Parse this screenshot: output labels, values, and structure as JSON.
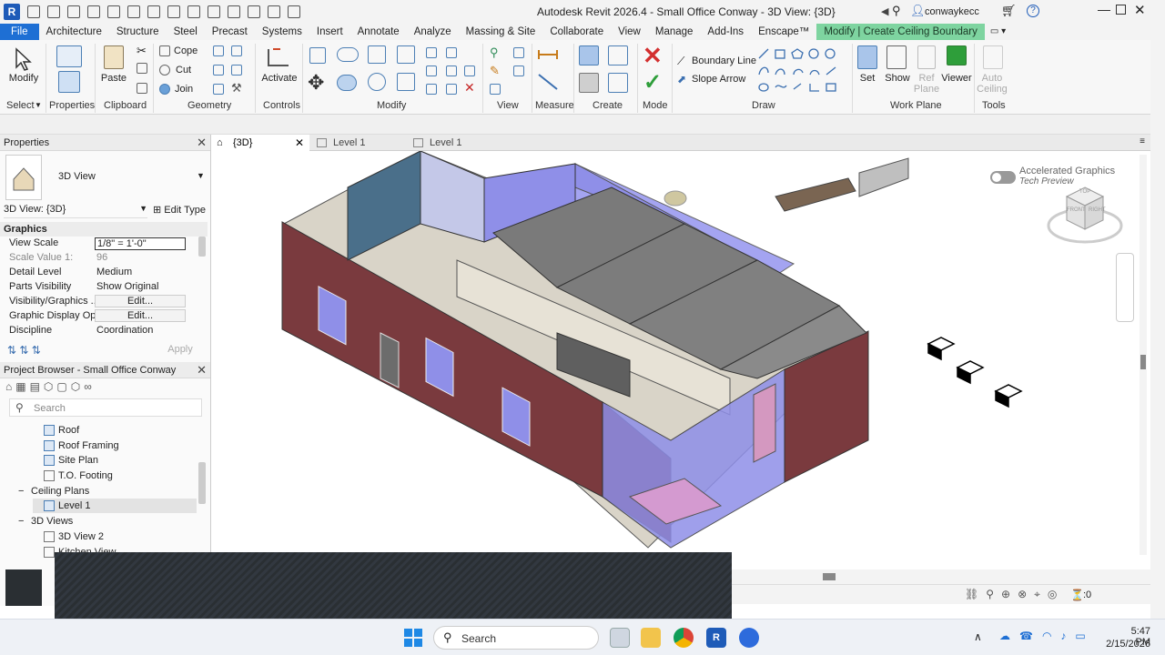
{
  "window": {
    "title": "Autodesk Revit 2026.4 - Small Office Conway - 3D View: {3D}",
    "user": "conwaykecc",
    "app_logo": "R"
  },
  "menu": {
    "items": [
      "File",
      "Architecture",
      "Structure",
      "Steel",
      "Precast",
      "Systems",
      "Insert",
      "Annotate",
      "Analyze",
      "Massing & Site",
      "Collaborate",
      "View",
      "Manage",
      "Add-Ins",
      "Enscape™",
      "Modify | Create Ceiling Boundary"
    ]
  },
  "ribbon": {
    "modify": "Modify",
    "paste": "Paste",
    "cope": "Cope",
    "cut": "Cut",
    "join": "Join",
    "activate": "Activate",
    "boundary_line": "Boundary Line",
    "slope_arrow": "Slope Arrow",
    "set": "Set",
    "show": "Show",
    "ref_plane": "Ref\nPlane",
    "viewer": "Viewer",
    "auto_ceiling": "Auto\nCeiling",
    "panels": {
      "select": "Select",
      "properties": "Properties",
      "clipboard": "Clipboard",
      "geometry": "Geometry",
      "controls": "Controls",
      "modify": "Modify",
      "view": "View",
      "measure": "Measure",
      "create": "Create",
      "mode": "Mode",
      "draw": "Draw",
      "work_plane": "Work Plane",
      "tools": "Tools"
    }
  },
  "properties": {
    "header": "Properties",
    "type_name": "3D View",
    "instance": "3D View: {3D}",
    "edit_type": "Edit Type",
    "group": "Graphics",
    "rows": [
      {
        "k": "View Scale",
        "v": "1/8\" = 1'-0\""
      },
      {
        "k": "Scale Value    1:",
        "v": "96"
      },
      {
        "k": "Detail Level",
        "v": "Medium"
      },
      {
        "k": "Parts Visibility",
        "v": "Show Original"
      },
      {
        "k": "Visibility/Graphics ...",
        "v": "Edit..."
      },
      {
        "k": "Graphic Display Op...",
        "v": "Edit..."
      },
      {
        "k": "Discipline",
        "v": "Coordination"
      }
    ],
    "apply": "Apply"
  },
  "browser": {
    "header": "Project Browser - Small Office Conway",
    "search_placeholder": "Search",
    "items": [
      "Roof",
      "Roof Framing",
      "Site Plan",
      "T.O. Footing",
      "Ceiling Plans",
      "Level 1",
      "3D Views",
      "3D View 2",
      "Kitchen View"
    ]
  },
  "tabs": [
    {
      "label": "{3D}"
    },
    {
      "label": "Level 1"
    },
    {
      "label": "Level 1"
    }
  ],
  "viewport": {
    "accel_title": "Accelerated Graphics",
    "accel_sub": "Tech Preview",
    "viewcube_top": "TOP",
    "viewcube_front": "FRONT",
    "viewcube_right": "RIGHT"
  },
  "status": {
    "filter_count": ":0"
  },
  "taskbar": {
    "search": "Search",
    "time": "5:47 PM",
    "date": "2/15/2026"
  },
  "colors": {
    "brick": "#7a3a3e",
    "glass": "#8f8fe8",
    "file_tab": "#1e6fd4",
    "context_tab": "#7ed4a0"
  }
}
